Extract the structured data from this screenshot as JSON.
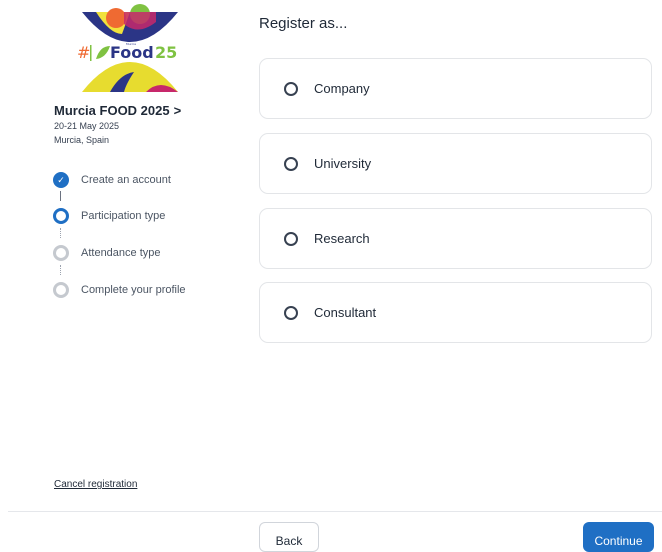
{
  "sidebar": {
    "logo": {
      "hash": "#",
      "word": "Food",
      "number": "25",
      "tiny": "Murcia"
    },
    "event_title": "Murcia FOOD 2025",
    "event_chevron": ">",
    "event_date": "20-21 May 2025",
    "event_place": "Murcia, Spain",
    "steps": [
      {
        "label": "Create an account",
        "state": "done"
      },
      {
        "label": "Participation type",
        "state": "active"
      },
      {
        "label": "Attendance type",
        "state": "pending"
      },
      {
        "label": "Complete your profile",
        "state": "pending"
      }
    ],
    "cancel_label": "Cancel registration"
  },
  "main": {
    "heading": "Register as...",
    "options": [
      {
        "label": "Company"
      },
      {
        "label": "University"
      },
      {
        "label": "Research"
      },
      {
        "label": "Consultant"
      }
    ]
  },
  "footer": {
    "back_label": "Back",
    "continue_label": "Continue"
  },
  "colors": {
    "primary": "#1f6fc4",
    "logo_navy": "#2b3586",
    "logo_yellow": "#f1e23b",
    "logo_orange": "#ef6a32",
    "logo_green": "#7fc242"
  }
}
